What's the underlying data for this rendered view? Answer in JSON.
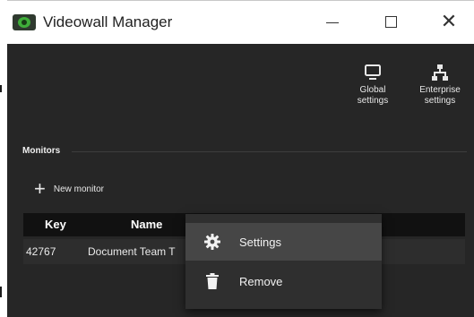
{
  "window": {
    "title": "Videowall Manager",
    "controls": {
      "minimize": "—",
      "maximize": "☐",
      "close": "✕"
    }
  },
  "toolbar": {
    "global_settings": {
      "line1": "Global",
      "line2": "settings",
      "icon": "monitor-icon"
    },
    "enterprise_settings": {
      "line1": "Enterprise",
      "line2": "settings",
      "icon": "hierarchy-icon"
    }
  },
  "monitors": {
    "section_title": "Monitors",
    "new_monitor_label": "New monitor",
    "columns": [
      "Key",
      "Name"
    ],
    "rows": [
      {
        "key": "42767",
        "name": "Document Team T"
      }
    ]
  },
  "context_menu": {
    "items": [
      {
        "label": "Settings",
        "icon": "gear-icon",
        "highlighted": true
      },
      {
        "label": "Remove",
        "icon": "trash-icon",
        "highlighted": false
      }
    ]
  },
  "colors": {
    "background": "#262626",
    "menu_bg": "#2f2f2f",
    "menu_highlight": "#464646",
    "header_bg": "#111111",
    "app_icon_green": "#3fae3a"
  }
}
